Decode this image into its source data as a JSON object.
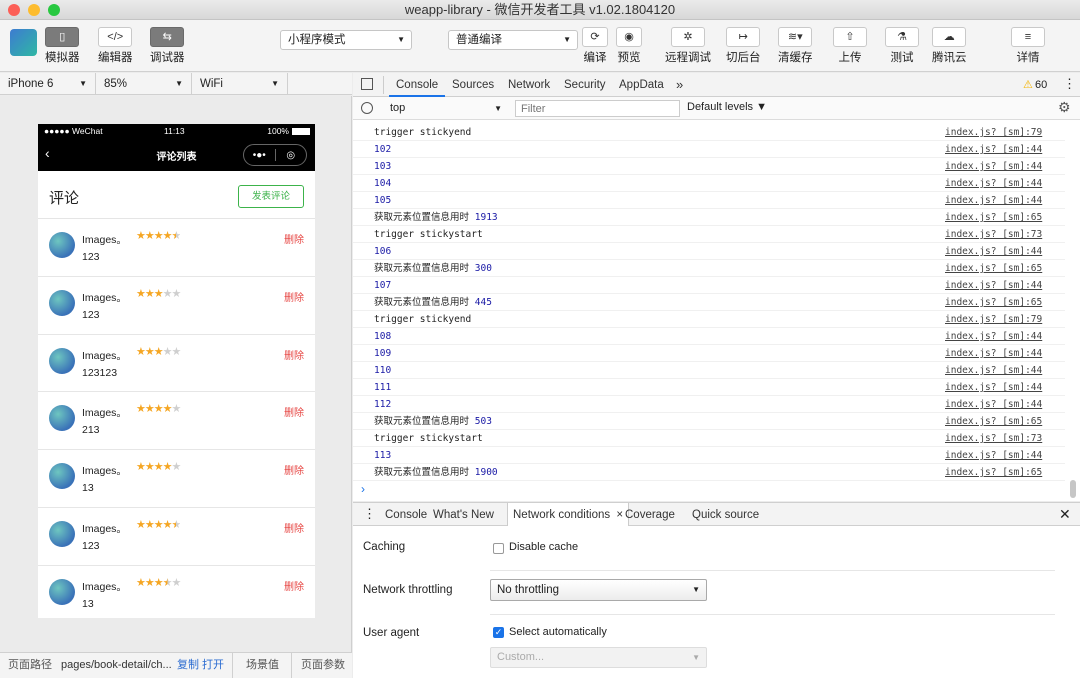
{
  "window": {
    "title": "weapp-library - 微信开发者工具 v1.02.1804120"
  },
  "toolbar": {
    "simulator": "模拟器",
    "editor": "编辑器",
    "debugger": "调试器",
    "mode_select": "小程序模式",
    "compile_select": "普通编译",
    "compile": "编译",
    "preview": "预览",
    "remote_debug": "远程调试",
    "background": "切后台",
    "clear_cache": "清缓存",
    "upload": "上传",
    "test": "测试",
    "tencent_cloud": "腾讯云",
    "details": "详情",
    "icons": {
      "simulator": "phone-icon",
      "editor": "code-icon",
      "debugger": "debug-icon",
      "compile": "refresh-icon",
      "preview": "eye-icon",
      "remote_debug": "bug-icon",
      "background": "switch-icon",
      "clear_cache": "layers-icon",
      "upload": "upload-icon",
      "test": "flask-icon",
      "tencent_cloud": "cloud-icon",
      "details": "menu-icon"
    }
  },
  "devicebar": {
    "device": "iPhone 6",
    "zoom": "85%",
    "network": "WiFi"
  },
  "phone": {
    "status": {
      "carrier": "●●●●● WeChat",
      "time": "11:13",
      "battery": "100%"
    },
    "nav_title": "评论列表",
    "capsule": {
      "more": "•●•",
      "close": "◎"
    },
    "header_title": "评论",
    "post_button": "发表评论",
    "comments": [
      {
        "name": "Images。",
        "stars": "★★★★★",
        "rating": 4.5,
        "text": "123",
        "delete": "删除"
      },
      {
        "name": "Images。",
        "stars": "★★★★★",
        "rating": 3,
        "text": "123",
        "delete": "删除"
      },
      {
        "name": "Images。",
        "stars": "★★★★★",
        "rating": 3,
        "text": "123123",
        "delete": "删除"
      },
      {
        "name": "Images。",
        "stars": "★★★★★",
        "rating": 4,
        "text": "213",
        "delete": "删除"
      },
      {
        "name": "Images。",
        "stars": "★★★★★",
        "rating": 4,
        "text": "13",
        "delete": "删除"
      },
      {
        "name": "Images。",
        "stars": "★★★★★",
        "rating": 4.5,
        "text": "123",
        "delete": "删除"
      },
      {
        "name": "Images。",
        "stars": "★★★★★",
        "rating": 3.5,
        "text": "13",
        "delete": "删除"
      }
    ]
  },
  "pathbar": {
    "label": "页面路径",
    "path": "pages/book-detail/ch...",
    "copy": "复制",
    "open": "打开",
    "scene": "场景值",
    "params": "页面参数"
  },
  "devtools": {
    "tabs": [
      "Console",
      "Sources",
      "Network",
      "Security",
      "AppData"
    ],
    "more": "»",
    "warnings": "60",
    "context": "top",
    "filter_placeholder": "Filter",
    "levels": "Default levels ▼",
    "logs": [
      {
        "msg": "trigger stickyend",
        "val": "",
        "src": "index.js? [sm]:79"
      },
      {
        "msg": "",
        "val": "102",
        "src": "index.js? [sm]:44"
      },
      {
        "msg": "",
        "val": "103",
        "src": "index.js? [sm]:44"
      },
      {
        "msg": "",
        "val": "104",
        "src": "index.js? [sm]:44"
      },
      {
        "msg": "",
        "val": "105",
        "src": "index.js? [sm]:44"
      },
      {
        "msg": "获取元素位置信息用时",
        "val": "1913",
        "src": "index.js? [sm]:65"
      },
      {
        "msg": "trigger stickystart",
        "val": "",
        "src": "index.js? [sm]:73"
      },
      {
        "msg": "",
        "val": "106",
        "src": "index.js? [sm]:44"
      },
      {
        "msg": "获取元素位置信息用时",
        "val": "300",
        "src": "index.js? [sm]:65"
      },
      {
        "msg": "",
        "val": "107",
        "src": "index.js? [sm]:44"
      },
      {
        "msg": "获取元素位置信息用时",
        "val": "445",
        "src": "index.js? [sm]:65"
      },
      {
        "msg": "trigger stickyend",
        "val": "",
        "src": "index.js? [sm]:79"
      },
      {
        "msg": "",
        "val": "108",
        "src": "index.js? [sm]:44"
      },
      {
        "msg": "",
        "val": "109",
        "src": "index.js? [sm]:44"
      },
      {
        "msg": "",
        "val": "110",
        "src": "index.js? [sm]:44"
      },
      {
        "msg": "",
        "val": "111",
        "src": "index.js? [sm]:44"
      },
      {
        "msg": "",
        "val": "112",
        "src": "index.js? [sm]:44"
      },
      {
        "msg": "获取元素位置信息用时",
        "val": "503",
        "src": "index.js? [sm]:65"
      },
      {
        "msg": "trigger stickystart",
        "val": "",
        "src": "index.js? [sm]:73"
      },
      {
        "msg": "",
        "val": "113",
        "src": "index.js? [sm]:44"
      },
      {
        "msg": "获取元素位置信息用时",
        "val": "1900",
        "src": "index.js? [sm]:65"
      }
    ],
    "prompt": "›",
    "drawer_tabs": [
      "Console",
      "What's New",
      "Network conditions",
      "Coverage",
      "Quick source"
    ],
    "drawer_close_tab": "×",
    "drawer": {
      "caching_label": "Caching",
      "disable_cache": "Disable cache",
      "throttling_label": "Network throttling",
      "throttling_value": "No throttling",
      "user_agent_label": "User agent",
      "select_auto": "Select automatically",
      "custom_placeholder": "Custom..."
    }
  },
  "colors": {
    "accent": "#1a73e8",
    "green": "#3cb34a",
    "delete": "#e64340",
    "star": "#f5a623",
    "star_off": "#cfcfcf"
  }
}
